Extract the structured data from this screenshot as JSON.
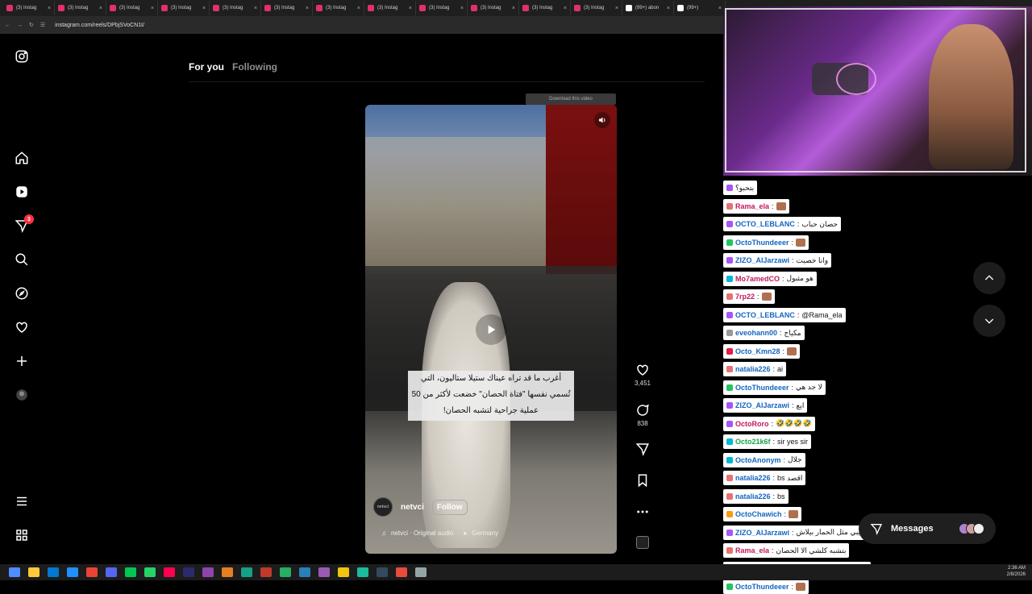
{
  "browser": {
    "tabs": [
      {
        "label": "(3) Instag",
        "color": "#e1306c"
      },
      {
        "label": "(3) Instag",
        "color": "#e1306c"
      },
      {
        "label": "(3) Instag",
        "color": "#e1306c"
      },
      {
        "label": "(3) Instag",
        "color": "#e1306c"
      },
      {
        "label": "(3) Instag",
        "color": "#e1306c"
      },
      {
        "label": "(3) Instag",
        "color": "#e1306c"
      },
      {
        "label": "(3) Instag",
        "color": "#e1306c"
      },
      {
        "label": "(3) Instag",
        "color": "#e1306c"
      },
      {
        "label": "(3) Instag",
        "color": "#e1306c"
      },
      {
        "label": "(3) Instag",
        "color": "#e1306c"
      },
      {
        "label": "(3) Instag",
        "color": "#e1306c"
      },
      {
        "label": "(3) Instag",
        "color": "#e1306c"
      },
      {
        "label": "(99+) abon",
        "color": "#ffffff"
      },
      {
        "label": "(99+)",
        "color": "#ffffff"
      }
    ],
    "url": "instagram.com/reels/DPbjSVoCN1t/"
  },
  "feed_tabs": {
    "for_you": "For you",
    "following": "Following"
  },
  "video": {
    "download_label": "Download this video",
    "caption": "أغرب ما قد تراه عيناك ستيلا ستاليون، التي تُسمي نفسها \"فتاة الحصان\" خضعت لأكثر من 50 عملية جراحية لتشبه الحصان!",
    "author": "netvci",
    "avatar_text": "netvci",
    "follow_label": "Follow",
    "audio": "netvci · Original audio",
    "location": "Germany"
  },
  "actions": {
    "likes": "3,451",
    "comments": "838"
  },
  "sidebar": {
    "notifications_count": "3"
  },
  "messages": {
    "label": "Messages"
  },
  "chat": [
    {
      "user": "",
      "text": "بتحبو؟",
      "badge": "#a855f7",
      "ucolor": "#333"
    },
    {
      "user": "Rama_ela",
      "text": "",
      "badge": "#e57373",
      "ucolor": "#c2185b"
    },
    {
      "user": "OCTO_LEBLANC",
      "text": "حصان حباب",
      "badge": "#a855f7",
      "ucolor": "#1565c0"
    },
    {
      "user": "OctoThundeeer",
      "text": "",
      "badge": "#22c55e",
      "ucolor": "#1565c0"
    },
    {
      "user": "ZIZO_AlJarzawi",
      "text": "وانا خصيت",
      "badge": "#a855f7",
      "ucolor": "#1565c0"
    },
    {
      "user": "Mo7amedCO",
      "text": "هو مثبول",
      "badge": "#06b6d4",
      "ucolor": "#c2185b"
    },
    {
      "user": "7rp22",
      "text": "",
      "badge": "#e57373",
      "ucolor": "#c2185b"
    },
    {
      "user": "OCTO_LEBLANC",
      "text": "@Rama_ela",
      "badge": "#a855f7",
      "ucolor": "#1565c0"
    },
    {
      "user": "eveohann00",
      "text": "مكياج",
      "badge": "#999999",
      "ucolor": "#1565c0"
    },
    {
      "user": "Octo_Kmn28",
      "text": "",
      "badge": "#e11d48",
      "ucolor": "#1565c0"
    },
    {
      "user": "natalia226",
      "text": "ai",
      "badge": "#e57373",
      "ucolor": "#1565c0"
    },
    {
      "user": "OctoThundeeer",
      "text": "لا جد هي",
      "badge": "#22c55e",
      "ucolor": "#1565c0"
    },
    {
      "user": "ZIZO_AlJarzawi",
      "text": "ايع",
      "badge": "#a855f7",
      "ucolor": "#1565c0"
    },
    {
      "user": "OctoRoro",
      "text": "🤣🤣🤣🤣",
      "badge": "#a855f7",
      "ucolor": "#c2185b"
    },
    {
      "user": "Octo21k6f",
      "text": "sir yes sir",
      "badge": "#06b6d4",
      "ucolor": "#16a34a"
    },
    {
      "user": "OctoAnonym",
      "text": "جلال",
      "badge": "#06b6d4",
      "ucolor": "#1565c0"
    },
    {
      "user": "natalia226",
      "text": "bs اقصد",
      "badge": "#e57373",
      "ucolor": "#1565c0"
    },
    {
      "user": "natalia226",
      "text": "bs",
      "badge": "#e57373",
      "ucolor": "#1565c0"
    },
    {
      "user": "OctoChawich",
      "text": "",
      "badge": "#f59e0b",
      "ucolor": "#1565c0"
    },
    {
      "user": "ZIZO_AlJarzawi",
      "text": "سبحان الله صحيبي مثل الحمار بيلاش",
      "badge": "#a855f7",
      "ucolor": "#1565c0"
    },
    {
      "user": "Rama_ela",
      "text": "بتشبه كلشي الا الحصان",
      "badge": "#e57373",
      "ucolor": "#c2185b"
    },
    {
      "user": "OCTO_LEBLANC",
      "text": "anonym رد شريك 😊",
      "badge": "#a855f7",
      "ucolor": "#1565c0"
    },
    {
      "user": "OctoThundeeer",
      "text": "",
      "badge": "#22c55e",
      "ucolor": "#1565c0"
    }
  ],
  "clock": {
    "time": "2:36 AM",
    "date": "2/8/2026"
  },
  "taskbar": [
    "#4f8cff",
    "#ffc83d",
    "#0078d4",
    "#1e90ff",
    "#ea4335",
    "#5865f2",
    "#00c853",
    "#25d366",
    "#ff0050",
    "#2b2b6b",
    "#8e44ad",
    "#e67e22",
    "#16a085",
    "#c0392b",
    "#27ae60",
    "#2980b9",
    "#9b59b6",
    "#f1c40f",
    "#1abc9c",
    "#34495e",
    "#e74c3c",
    "#95a5a6"
  ]
}
